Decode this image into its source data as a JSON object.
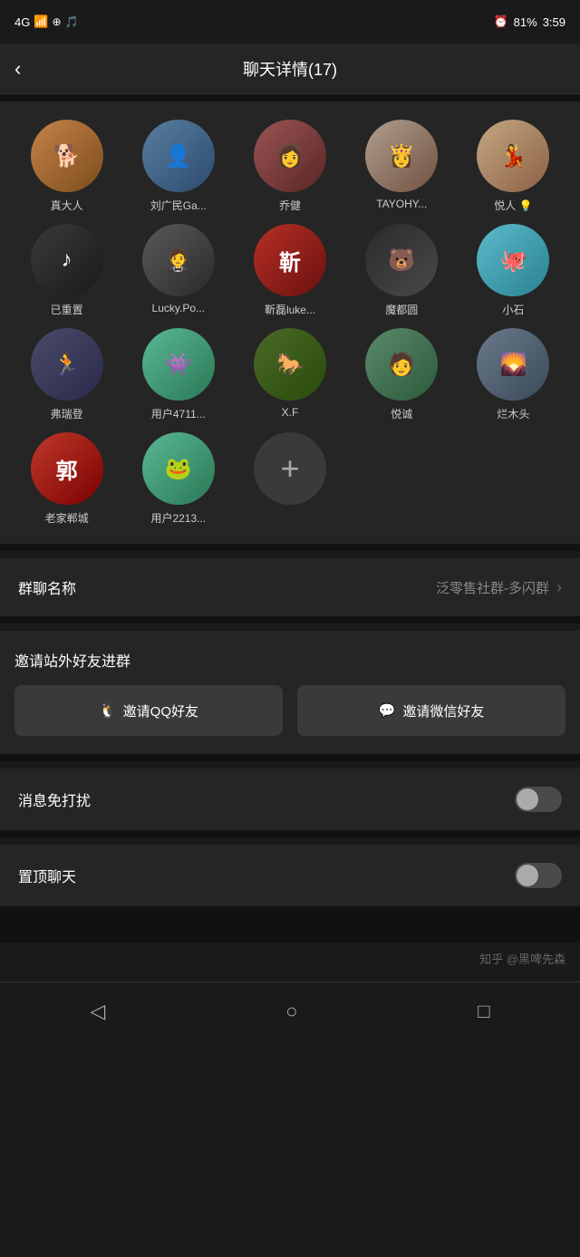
{
  "statusBar": {
    "signal": "4G",
    "time": "3:59",
    "battery": "81%"
  },
  "header": {
    "backLabel": "‹",
    "title": "聊天详情(17)"
  },
  "members": [
    {
      "id": 1,
      "name": "真大人",
      "avatarClass": "av-dog",
      "emoji": "🐕"
    },
    {
      "id": 2,
      "name": "刘广民Ga...",
      "avatarClass": "av-man1",
      "emoji": "👤"
    },
    {
      "id": 3,
      "name": "乔健",
      "avatarClass": "av-girl1",
      "emoji": "👩"
    },
    {
      "id": 4,
      "name": "TAYOHY...",
      "avatarClass": "av-lady1",
      "emoji": "👸"
    },
    {
      "id": 5,
      "name": "悦人 💡",
      "avatarClass": "av-lady2",
      "emoji": "💃"
    },
    {
      "id": 6,
      "name": "已重置",
      "avatarClass": "av-tiktok",
      "emoji": "🎵"
    },
    {
      "id": 7,
      "name": "Lucky.Po...",
      "avatarClass": "av-suit",
      "emoji": "🤵"
    },
    {
      "id": 8,
      "name": "靳磊luke...",
      "avatarClass": "av-red-char",
      "emoji": "靳"
    },
    {
      "id": 9,
      "name": "魔都圆",
      "avatarClass": "av-bear",
      "emoji": "🐻"
    },
    {
      "id": 10,
      "name": "小石",
      "avatarClass": "av-octopus",
      "emoji": "🐙"
    },
    {
      "id": 11,
      "name": "弗瑞登",
      "avatarClass": "av-runner",
      "emoji": "🏃"
    },
    {
      "id": 12,
      "name": "用户4711...",
      "avatarClass": "av-monster",
      "emoji": "👾"
    },
    {
      "id": 13,
      "name": "X.F",
      "avatarClass": "av-horse",
      "emoji": "🐎"
    },
    {
      "id": 14,
      "name": "悦诚",
      "avatarClass": "av-man2",
      "emoji": "🧑"
    },
    {
      "id": 15,
      "name": "烂木头",
      "avatarClass": "av-outdoor",
      "emoji": "🌄"
    },
    {
      "id": 16,
      "name": "老家郸城",
      "avatarClass": "av-郭",
      "emoji": "郭"
    },
    {
      "id": 17,
      "name": "用户2213...",
      "avatarClass": "av-frog",
      "emoji": "🐸"
    }
  ],
  "addButton": {
    "label": "+"
  },
  "settings": {
    "groupName": {
      "label": "群聊名称",
      "value": "泛零售社群-多闪群"
    },
    "invite": {
      "title": "邀请站外好友进群",
      "qqButton": "邀请QQ好友",
      "wechatButton": "邀请微信好友"
    },
    "doNotDisturb": {
      "label": "消息免打扰",
      "enabled": false
    },
    "pinChat": {
      "label": "置顶聊天",
      "enabled": false
    }
  },
  "bottomNav": {
    "back": "◁",
    "home": "○",
    "recent": "□",
    "watermark": "知乎 @黑啤先森"
  }
}
